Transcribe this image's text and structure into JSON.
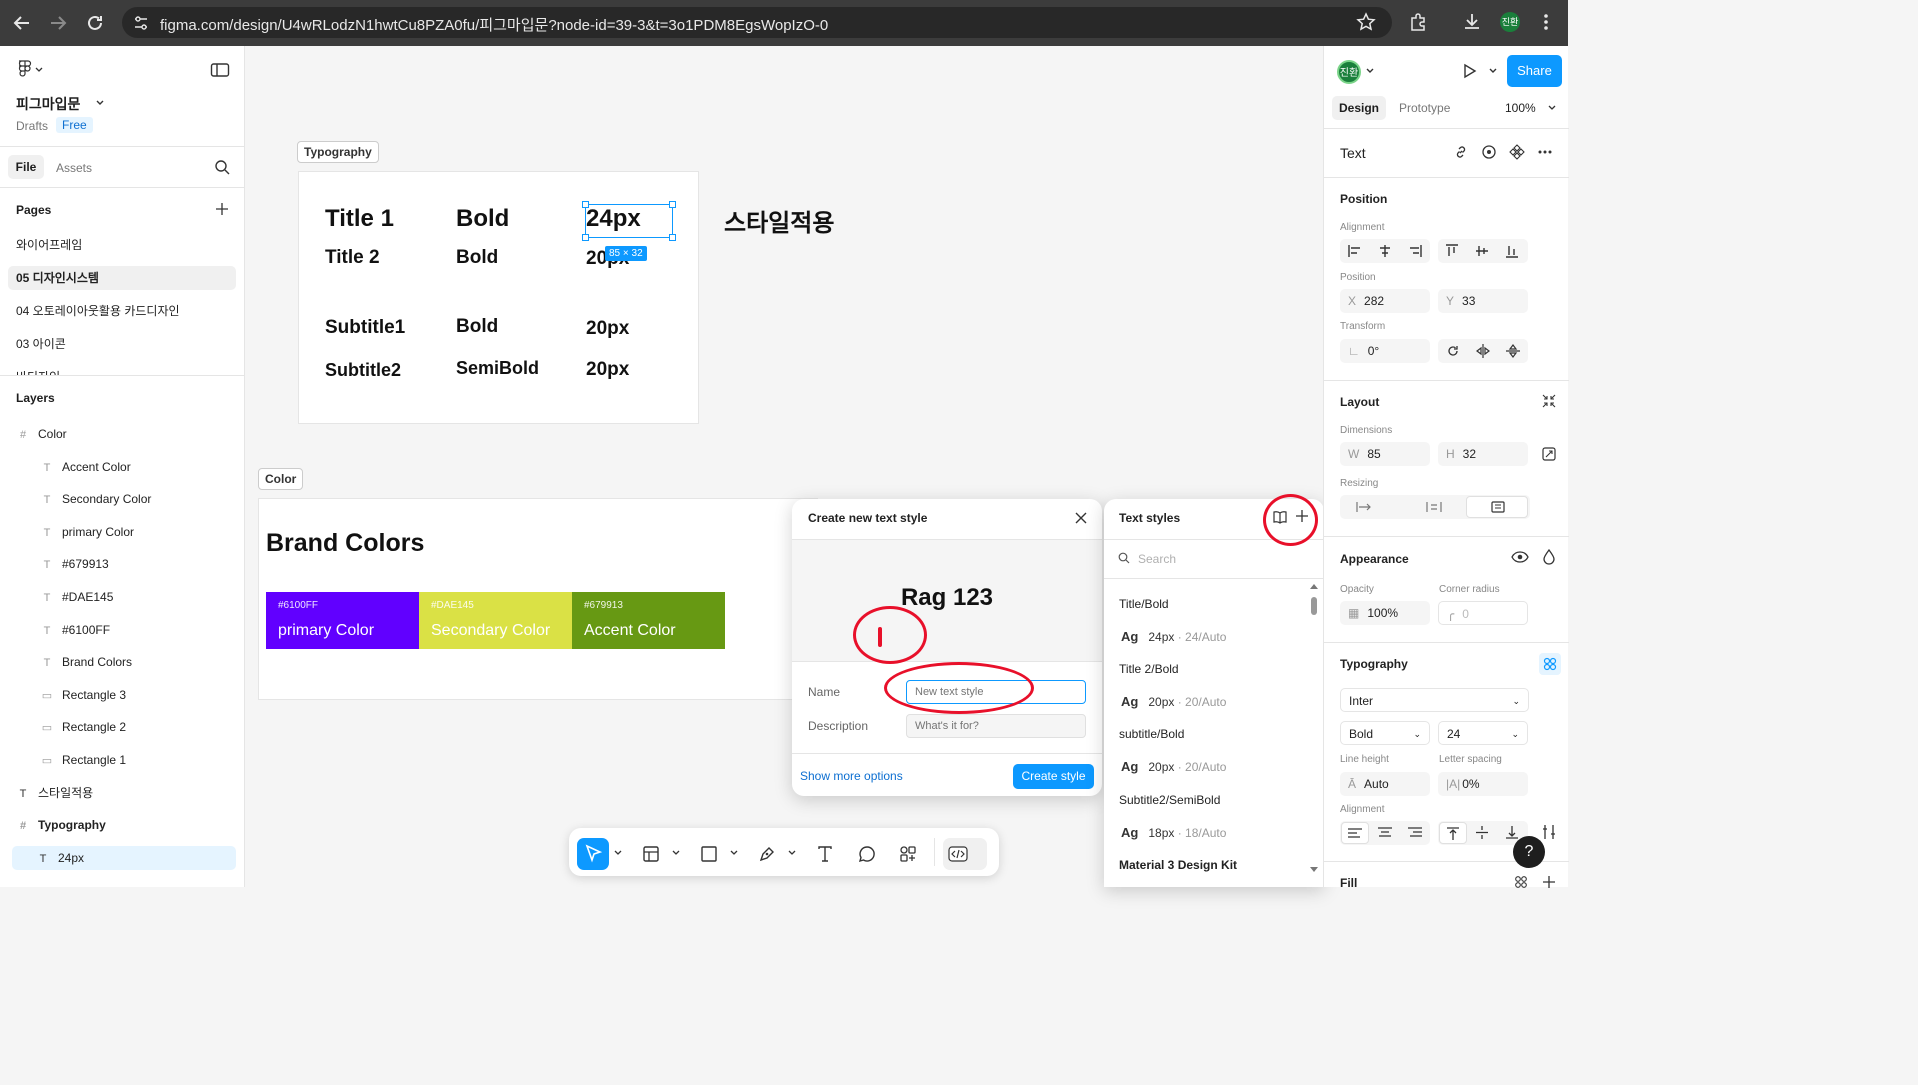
{
  "browser": {
    "url": "figma.com/design/U4wRLodzN1hwtCu8PZA0fu/피그마입문?node-id=39-3&t=3o1PDM8EgsWopIzO-0",
    "profile_label": "진환"
  },
  "left_panel": {
    "file_name": "피그마입문",
    "location": "Drafts",
    "plan_badge": "Free",
    "tabs": [
      "File",
      "Assets"
    ],
    "pages_title": "Pages",
    "pages": [
      "와이어프레임",
      "05 디자인시스템",
      "04 오토레이아웃활용 카드디자인",
      "03 아이콘",
      "바디자인"
    ],
    "layers_title": "Layers",
    "layers": [
      {
        "name": "Color",
        "type": "frame",
        "level": 0
      },
      {
        "name": "Accent Color",
        "type": "text",
        "level": 1
      },
      {
        "name": "Secondary Color",
        "type": "text",
        "level": 1
      },
      {
        "name": "primary Color",
        "type": "text",
        "level": 1
      },
      {
        "name": "#679913",
        "type": "text",
        "level": 1
      },
      {
        "name": "#DAE145",
        "type": "text",
        "level": 1
      },
      {
        "name": "#6100FF",
        "type": "text",
        "level": 1
      },
      {
        "name": "Brand Colors",
        "type": "text",
        "level": 1
      },
      {
        "name": "Rectangle 3",
        "type": "rect",
        "level": 1
      },
      {
        "name": "Rectangle 2",
        "type": "rect",
        "level": 1
      },
      {
        "name": "Rectangle 1",
        "type": "rect",
        "level": 1
      },
      {
        "name": "스타일적용",
        "type": "text",
        "level": 0
      },
      {
        "name": "Typography",
        "type": "frame",
        "level": 0
      },
      {
        "name": "24px",
        "type": "text",
        "level": 1
      }
    ]
  },
  "canvas": {
    "typography_tag": "Typography",
    "typography_rows": [
      {
        "name": "Title 1",
        "weight": "Bold",
        "size": "24px"
      },
      {
        "name": "Title 2",
        "weight": "Bold",
        "size": "20px"
      },
      {
        "name": "Subtitle1",
        "weight": "Bold",
        "size": "20px"
      },
      {
        "name": "Subtitle2",
        "weight": "SemiBold",
        "size": "20px"
      }
    ],
    "selection_size": "85 × 32",
    "side_label": "스타일적용",
    "color_tag": "Color",
    "brand_title": "Brand Colors",
    "swatches": [
      {
        "hex": "#6100FF",
        "name": "primary Color",
        "color": "#6100FF"
      },
      {
        "hex": "#DAE145",
        "name": "Secondary Color",
        "color": "#DAE145"
      },
      {
        "hex": "#679913",
        "name": "Accent Color",
        "color": "#679913"
      }
    ]
  },
  "create_style_modal": {
    "title": "Create new text style",
    "preview": "Rag 123",
    "name_label": "Name",
    "name_placeholder": "New text style",
    "description_label": "Description",
    "description_placeholder": "What's it for?",
    "more_options": "Show more options",
    "create_button": "Create style"
  },
  "text_styles_panel": {
    "title": "Text styles",
    "search_placeholder": "Search",
    "styles": [
      {
        "name": "Title/Bold",
        "sample": "Ag",
        "size": "24px",
        "meta": "· 24/Auto"
      },
      {
        "name": "Title 2/Bold",
        "sample": "Ag",
        "size": "20px",
        "meta": "· 20/Auto"
      },
      {
        "name": "subtitle/Bold",
        "sample": "Ag",
        "size": "20px",
        "meta": "· 20/Auto"
      },
      {
        "name": "Subtitle2/SemiBold",
        "sample": "Ag",
        "size": "18px",
        "meta": "· 18/Auto"
      }
    ],
    "library": "Material 3 Design Kit"
  },
  "right_panel": {
    "avatar": "진환",
    "share": "Share",
    "tabs": [
      "Design",
      "Prototype"
    ],
    "zoom": "100%",
    "selection_type": "Text",
    "position_title": "Position",
    "alignment_label": "Alignment",
    "position_label": "Position",
    "x_label": "X",
    "x": "282",
    "y_label": "Y",
    "y": "33",
    "transform_label": "Transform",
    "rotation": "0°",
    "layout_title": "Layout",
    "dimensions_label": "Dimensions",
    "w_label": "W",
    "w": "85",
    "h_label": "H",
    "h": "32",
    "resizing_label": "Resizing",
    "appearance_title": "Appearance",
    "opacity_label": "Opacity",
    "opacity": "100%",
    "radius_label": "Corner radius",
    "radius": "0",
    "typography_title": "Typography",
    "font_family": "Inter",
    "font_weight": "Bold",
    "font_size": "24",
    "line_height_label": "Line height",
    "line_height": "Auto",
    "letter_spacing_label": "Letter spacing",
    "letter_spacing": "0%",
    "text_alignment_label": "Alignment",
    "fill_title": "Fill"
  },
  "help": "?"
}
